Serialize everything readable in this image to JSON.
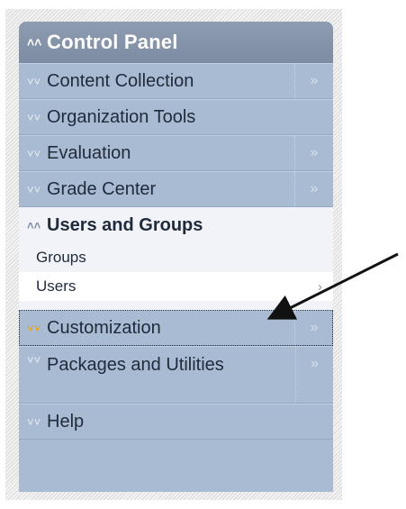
{
  "control_panel": {
    "title": "Control Panel",
    "items_top": [
      {
        "label": "Content Collection",
        "has_side": true
      },
      {
        "label": "Organization Tools",
        "has_side": false
      },
      {
        "label": "Evaluation",
        "has_side": true
      },
      {
        "label": "Grade Center",
        "has_side": true
      }
    ],
    "expanded_section": {
      "label": "Users and Groups",
      "subitems": [
        "Groups",
        "Users"
      ]
    },
    "items_bottom": [
      {
        "label": "Customization",
        "has_side": true
      },
      {
        "label": "Packages and Utilities",
        "has_side": true
      },
      {
        "label": "Help",
        "has_side": false
      }
    ],
    "glyphs": {
      "collapse": "≪",
      "expand": "≫",
      "arrow_right": ">"
    }
  }
}
